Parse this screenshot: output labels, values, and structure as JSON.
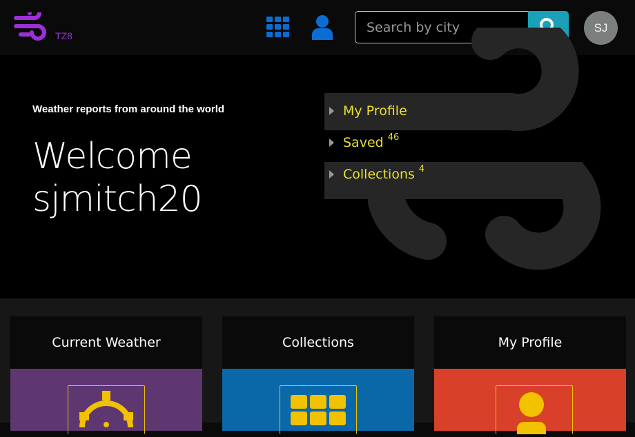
{
  "header": {
    "logo_text": "TZ8",
    "logo_icon": "wind-icon",
    "grid_icon": "apps-grid-icon",
    "user_icon": "user-icon",
    "search": {
      "placeholder": "Search by city",
      "icon": "search-icon"
    },
    "avatar_initials": "SJ"
  },
  "hero": {
    "tagline": "Weather reports from around the world",
    "welcome_line1": "Welcome",
    "welcome_line2": "sjmitch20",
    "menu": [
      {
        "label": "My Profile",
        "count": ""
      },
      {
        "label": "Saved",
        "count": "46"
      },
      {
        "label": "Collections",
        "count": "4"
      }
    ]
  },
  "cards": [
    {
      "title": "Current Weather",
      "color": "#5e3770",
      "icon": "crosshair-icon"
    },
    {
      "title": "Collections",
      "color": "#0a68a8",
      "icon": "grid-icon"
    },
    {
      "title": "My Profile",
      "color": "#d9402a",
      "icon": "profile-icon"
    }
  ],
  "colors": {
    "accent_purple": "#9b30d9",
    "accent_blue": "#0a6dd4",
    "search_button": "#1aa1b8",
    "menu_text": "#e8df2f",
    "icon_yellow": "#f2c100"
  }
}
